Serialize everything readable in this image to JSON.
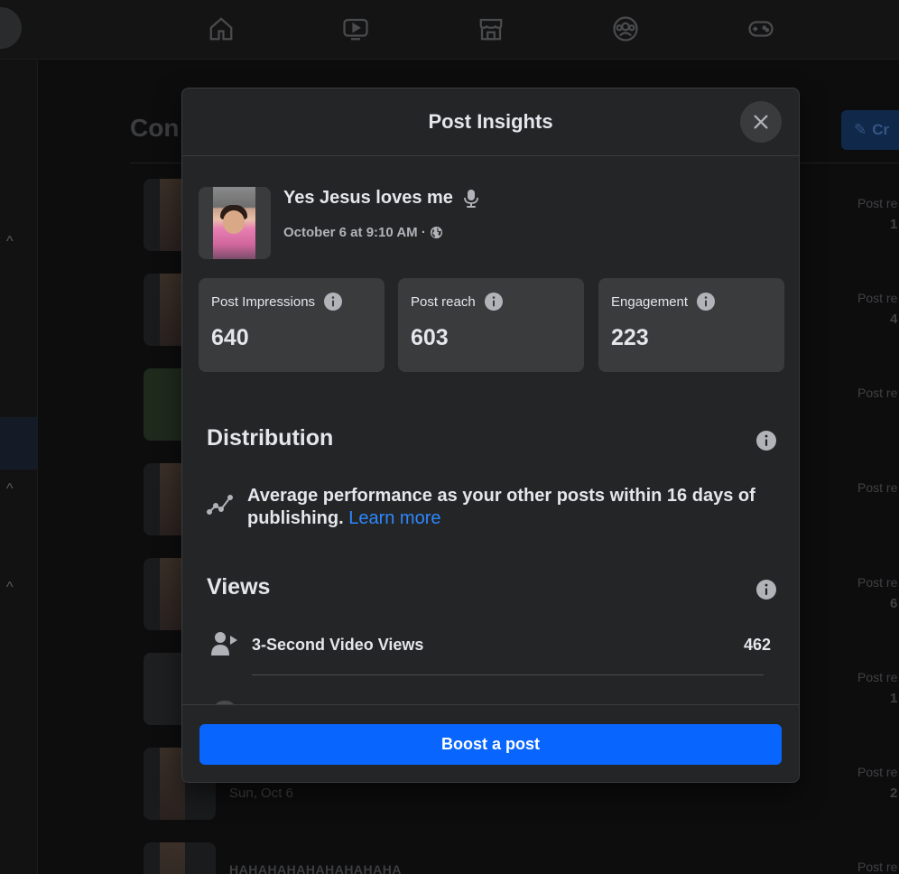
{
  "modal": {
    "title": "Post Insights",
    "post": {
      "title": "Yes Jesus loves me",
      "date": "October 6 at 9:10 AM ·"
    },
    "metrics": [
      {
        "label": "Post Impressions",
        "value": "640"
      },
      {
        "label": "Post reach",
        "value": "603"
      },
      {
        "label": "Engagement",
        "value": "223"
      }
    ],
    "distribution": {
      "title": "Distribution",
      "text": "Average performance as your other posts within 16 days of publishing.",
      "link": "Learn more"
    },
    "views": {
      "title": "Views",
      "rows": [
        {
          "label": "3-Second Video Views",
          "value": "462"
        }
      ]
    },
    "boost_label": "Boost a post"
  },
  "background": {
    "page_title": "Con",
    "create_label": "Cr",
    "rows": [
      {
        "reach_label": "Post re",
        "reach_value": "1"
      },
      {
        "reach_label": "Post re",
        "reach_value": "4"
      },
      {
        "reach_label": "Post re",
        "reach_value": ""
      },
      {
        "reach_label": "Post re",
        "reach_value": ""
      },
      {
        "reach_label": "Post re",
        "reach_value": "6"
      },
      {
        "reach_label": "Post re",
        "reach_value": "1"
      },
      {
        "reach_label": "Post re",
        "reach_value": "2"
      },
      {
        "reach_label": "Post re",
        "reach_value": ""
      }
    ],
    "row7_date": "Sun, Oct 6",
    "row8_text": "HAHAHAHAHAHAHAHAHA"
  },
  "icons": {
    "nav": [
      "home-icon",
      "video-icon",
      "marketplace-icon",
      "groups-icon",
      "gaming-icon"
    ],
    "close": "close-icon",
    "info": "info-icon",
    "microphone": "microphone-icon",
    "globe": "globe-icon",
    "trend": "trend-icon",
    "views": "person-video-icon"
  },
  "colors": {
    "modal_bg": "#242526",
    "card_bg": "#3a3b3c",
    "accent": "#0866ff",
    "link": "#2d88ff"
  }
}
